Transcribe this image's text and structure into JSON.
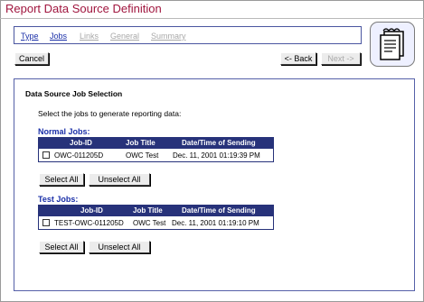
{
  "page_title": "Report Data Source Definition",
  "nav": {
    "tabs": [
      {
        "label": "Type",
        "state": "link"
      },
      {
        "label": "Jobs",
        "state": "active"
      },
      {
        "label": "Links",
        "state": "disabled"
      },
      {
        "label": "General",
        "state": "disabled"
      },
      {
        "label": "Summary",
        "state": "disabled"
      }
    ]
  },
  "toolbar": {
    "cancel_label": "Cancel",
    "back_label": "<- Back",
    "next_label": "Next ->"
  },
  "section": {
    "title": "Data Source Job Selection",
    "instruction": "Select the jobs to generate reporting data:"
  },
  "normal_jobs": {
    "label": "Normal Jobs:",
    "columns": [
      "Job-ID",
      "Job Title",
      "Date/Time of Sending"
    ],
    "rows": [
      {
        "checked": false,
        "job_id": "OWC-011205D",
        "job_title": "OWC Test",
        "date_time": "Dec. 11, 2001 01:19:39 PM"
      }
    ],
    "select_all_label": "Select All",
    "unselect_all_label": "Unselect All"
  },
  "test_jobs": {
    "label": "Test Jobs:",
    "columns": [
      "Job-ID",
      "Job Title",
      "Date/Time of Sending"
    ],
    "rows": [
      {
        "checked": false,
        "job_id": "TEST-OWC-011205D",
        "job_title": "OWC Test",
        "date_time": "Dec. 11, 2001 01:19:10 PM"
      }
    ],
    "select_all_label": "Select All",
    "unselect_all_label": "Unselect All"
  },
  "colors": {
    "title": "#a0153e",
    "link": "#1a2fa8",
    "header_bg": "#27327a",
    "border": "#5560a8"
  },
  "icons": {
    "wizard": "document-icon"
  }
}
